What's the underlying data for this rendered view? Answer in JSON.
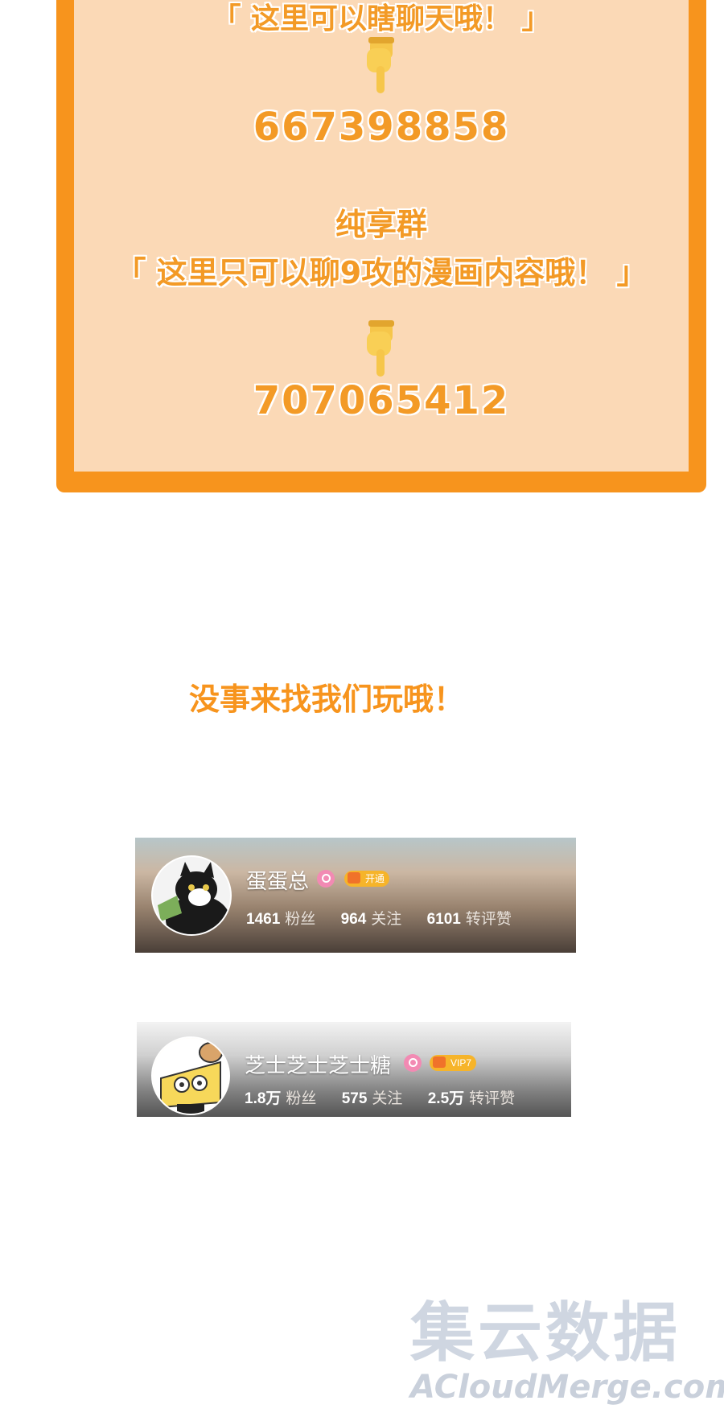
{
  "panel": {
    "top_line": "「 这里可以瞎聊天哦！ 」",
    "group1_number": "667398858",
    "group2_title": "纯享群",
    "group2_desc": "「 这里只可以聊9攻的漫画内容哦！ 」",
    "group2_number": "707065412",
    "hand_icon": "pointing-down-hand-icon"
  },
  "invite_text": "没事来找我们玩哦！",
  "profiles": [
    {
      "name": "蛋蛋总",
      "vip_label": "开通",
      "stats": [
        {
          "value": "1461",
          "label": "粉丝"
        },
        {
          "value": "964",
          "label": "关注"
        },
        {
          "value": "6101",
          "label": "转评赞"
        }
      ]
    },
    {
      "name": "芝士芝士芝士糖",
      "vip_label": "VIP7",
      "stats": [
        {
          "value": "1.8万",
          "label": "粉丝"
        },
        {
          "value": "575",
          "label": "关注"
        },
        {
          "value": "2.5万",
          "label": "转评赞"
        }
      ]
    }
  ],
  "watermark": {
    "cn": "集云数据",
    "en": "ACloudMerge.com"
  },
  "colors": {
    "accent_orange": "#f7941d",
    "panel_fill": "#fbd9b6"
  }
}
